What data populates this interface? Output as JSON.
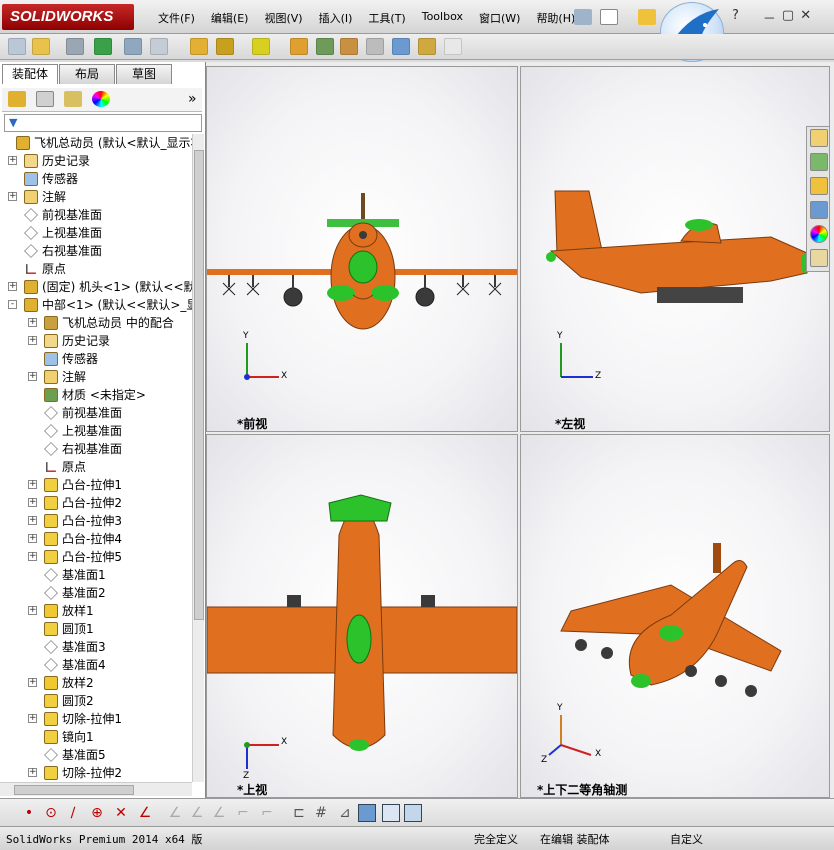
{
  "app": {
    "logo_text": "SOLIDWORKS"
  },
  "menu": [
    "文件(F)",
    "编辑(E)",
    "视图(V)",
    "插入(I)",
    "工具(T)",
    "Toolbox",
    "窗口(W)",
    "帮助(H)"
  ],
  "window_controls": {
    "help": "?",
    "minimize": "－",
    "restore": "▢",
    "close": "✕"
  },
  "left_panel": {
    "tabs": [
      "装配体",
      "布局",
      "草图"
    ],
    "expand_glyph": "»",
    "tree": [
      {
        "label": "飞机总动员  (默认<默认_显示状",
        "indent": 0,
        "exp": "",
        "icon": "assembly-icon"
      },
      {
        "label": "历史记录",
        "indent": 1,
        "exp": "+",
        "icon": "history-icon"
      },
      {
        "label": "传感器",
        "indent": 1,
        "exp": "",
        "icon": "sensor-icon"
      },
      {
        "label": "注解",
        "indent": 1,
        "exp": "+",
        "icon": "annotation-icon"
      },
      {
        "label": "前视基准面",
        "indent": 1,
        "exp": "",
        "icon": "plane-icon"
      },
      {
        "label": "上视基准面",
        "indent": 1,
        "exp": "",
        "icon": "plane-icon"
      },
      {
        "label": "右视基准面",
        "indent": 1,
        "exp": "",
        "icon": "plane-icon"
      },
      {
        "label": "原点",
        "indent": 1,
        "exp": "",
        "icon": "origin-icon"
      },
      {
        "label": "(固定) 机头<1> (默认<<默认",
        "indent": 1,
        "exp": "+",
        "icon": "part-icon"
      },
      {
        "label": "中部<1> (默认<<默认>_显示",
        "indent": 1,
        "exp": "-",
        "icon": "part-icon"
      },
      {
        "label": "飞机总动员 中的配合",
        "indent": 2,
        "exp": "+",
        "icon": "mate-icon"
      },
      {
        "label": "历史记录",
        "indent": 2,
        "exp": "+",
        "icon": "history-icon"
      },
      {
        "label": "传感器",
        "indent": 2,
        "exp": "",
        "icon": "sensor-icon"
      },
      {
        "label": "注解",
        "indent": 2,
        "exp": "+",
        "icon": "annotation-icon"
      },
      {
        "label": "材质 <未指定>",
        "indent": 2,
        "exp": "",
        "icon": "material-icon"
      },
      {
        "label": "前视基准面",
        "indent": 2,
        "exp": "",
        "icon": "plane-icon"
      },
      {
        "label": "上视基准面",
        "indent": 2,
        "exp": "",
        "icon": "plane-icon"
      },
      {
        "label": "右视基准面",
        "indent": 2,
        "exp": "",
        "icon": "plane-icon"
      },
      {
        "label": "原点",
        "indent": 2,
        "exp": "",
        "icon": "origin-icon"
      },
      {
        "label": "凸台-拉伸1",
        "indent": 2,
        "exp": "+",
        "icon": "extrude-icon"
      },
      {
        "label": "凸台-拉伸2",
        "indent": 2,
        "exp": "+",
        "icon": "extrude-icon"
      },
      {
        "label": "凸台-拉伸3",
        "indent": 2,
        "exp": "+",
        "icon": "extrude-icon"
      },
      {
        "label": "凸台-拉伸4",
        "indent": 2,
        "exp": "+",
        "icon": "extrude-icon"
      },
      {
        "label": "凸台-拉伸5",
        "indent": 2,
        "exp": "+",
        "icon": "extrude-icon"
      },
      {
        "label": "基准面1",
        "indent": 2,
        "exp": "",
        "icon": "plane-icon"
      },
      {
        "label": "基准面2",
        "indent": 2,
        "exp": "",
        "icon": "plane-icon"
      },
      {
        "label": "放样1",
        "indent": 2,
        "exp": "+",
        "icon": "loft-icon"
      },
      {
        "label": "圆顶1",
        "indent": 2,
        "exp": "",
        "icon": "dome-icon"
      },
      {
        "label": "基准面3",
        "indent": 2,
        "exp": "",
        "icon": "plane-icon"
      },
      {
        "label": "基准面4",
        "indent": 2,
        "exp": "",
        "icon": "plane-icon"
      },
      {
        "label": "放样2",
        "indent": 2,
        "exp": "+",
        "icon": "loft-icon"
      },
      {
        "label": "圆顶2",
        "indent": 2,
        "exp": "",
        "icon": "dome-icon"
      },
      {
        "label": "切除-拉伸1",
        "indent": 2,
        "exp": "+",
        "icon": "cut-icon"
      },
      {
        "label": "镜向1",
        "indent": 2,
        "exp": "",
        "icon": "mirror-icon"
      },
      {
        "label": "基准面5",
        "indent": 2,
        "exp": "",
        "icon": "plane-icon"
      },
      {
        "label": "切除-拉伸2",
        "indent": 2,
        "exp": "+",
        "icon": "cut-icon"
      }
    ]
  },
  "viewports": {
    "front": {
      "label": "*前视"
    },
    "left": {
      "label": "*左视"
    },
    "top": {
      "label": "*上视"
    },
    "iso": {
      "label": "*上下二等角轴测"
    }
  },
  "axes": {
    "x": "X",
    "y": "Y",
    "z": "Z"
  },
  "status_bar": {
    "version": "SolidWorks Premium 2014 x64 版",
    "state": "完全定义",
    "mode": "在编辑 装配体",
    "units": "自定义"
  },
  "colors": {
    "orange": "#e07020",
    "green": "#33cc33",
    "dark": "#3a3a3a"
  }
}
